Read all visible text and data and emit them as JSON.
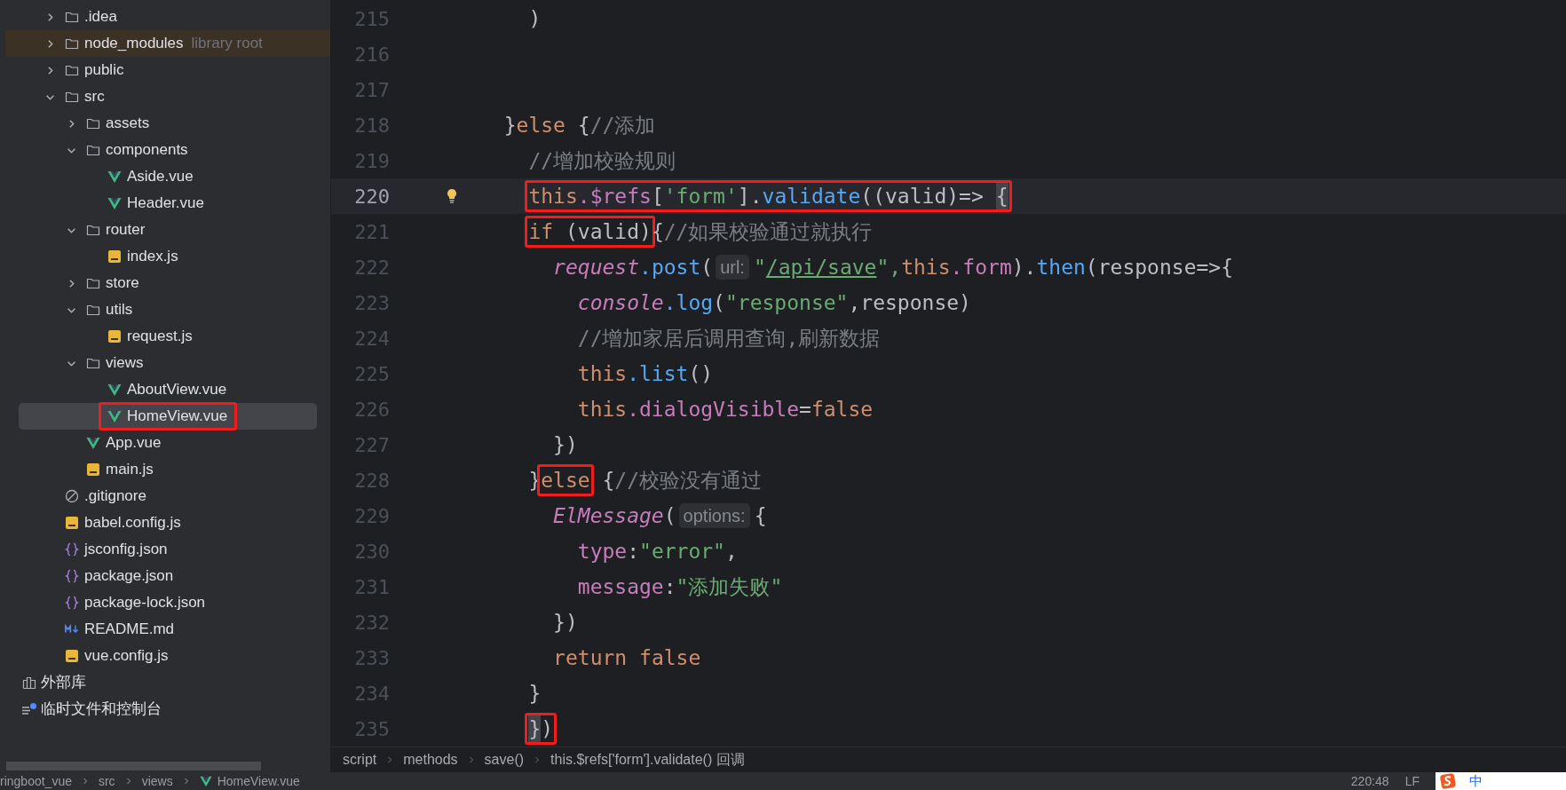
{
  "project_tree": {
    "items": [
      {
        "name": ".idea",
        "kind": "folder",
        "expanded": false,
        "selected": false,
        "boxed": false
      },
      {
        "name": "node_modules",
        "kind": "folder",
        "expanded": false,
        "selected": false,
        "boxed": false,
        "note": "library root"
      },
      {
        "name": "public",
        "kind": "folder",
        "expanded": false,
        "selected": false,
        "boxed": false
      },
      {
        "name": "src",
        "kind": "folder",
        "expanded": true,
        "selected": false,
        "boxed": false,
        "children": [
          {
            "name": "assets",
            "kind": "folder",
            "expanded": false,
            "selected": false,
            "boxed": false
          },
          {
            "name": "components",
            "kind": "folder",
            "expanded": true,
            "selected": false,
            "boxed": false,
            "children": [
              {
                "name": "Aside.vue",
                "kind": "vue",
                "selected": false,
                "boxed": false
              },
              {
                "name": "Header.vue",
                "kind": "vue",
                "selected": false,
                "boxed": false
              }
            ]
          },
          {
            "name": "router",
            "kind": "folder",
            "expanded": true,
            "selected": false,
            "boxed": false,
            "children": [
              {
                "name": "index.js",
                "kind": "js",
                "selected": false,
                "boxed": false
              }
            ]
          },
          {
            "name": "store",
            "kind": "folder",
            "expanded": false,
            "selected": false,
            "boxed": false
          },
          {
            "name": "utils",
            "kind": "folder",
            "expanded": true,
            "selected": false,
            "boxed": false,
            "children": [
              {
                "name": "request.js",
                "kind": "js",
                "selected": false,
                "boxed": false
              }
            ]
          },
          {
            "name": "views",
            "kind": "folder",
            "expanded": true,
            "selected": false,
            "boxed": false,
            "children": [
              {
                "name": "AboutView.vue",
                "kind": "vue",
                "selected": false,
                "boxed": false
              },
              {
                "name": "HomeView.vue",
                "kind": "vue",
                "selected": true,
                "boxed": true
              }
            ]
          },
          {
            "name": "App.vue",
            "kind": "vue",
            "selected": false,
            "boxed": false
          },
          {
            "name": "main.js",
            "kind": "js",
            "selected": false,
            "boxed": false
          }
        ]
      },
      {
        "name": ".gitignore",
        "kind": "gitignore",
        "selected": false,
        "boxed": false
      },
      {
        "name": "babel.config.js",
        "kind": "js",
        "selected": false,
        "boxed": false
      },
      {
        "name": "jsconfig.json",
        "kind": "json",
        "selected": false,
        "boxed": false
      },
      {
        "name": "package.json",
        "kind": "json",
        "selected": false,
        "boxed": false
      },
      {
        "name": "package-lock.json",
        "kind": "json",
        "selected": false,
        "boxed": false
      },
      {
        "name": "README.md",
        "kind": "md",
        "selected": false,
        "boxed": false
      },
      {
        "name": "vue.config.js",
        "kind": "js",
        "selected": false,
        "boxed": false
      }
    ],
    "extras": [
      {
        "name": "外部库",
        "kind": "library"
      },
      {
        "name": "临时文件和控制台",
        "kind": "scratches"
      }
    ]
  },
  "editor": {
    "lines": [
      {
        "n": "215",
        "current": false,
        "bulb": false,
        "tokens": [
          {
            "t": "    )",
            "kind": "plain"
          }
        ]
      },
      {
        "n": "216",
        "current": false,
        "bulb": false
      },
      {
        "n": "217",
        "current": false,
        "bulb": false
      },
      {
        "n": "218",
        "current": false,
        "bulb": false,
        "tokens": [
          {
            "t": "  }",
            "kind": "plain"
          },
          {
            "t": "else",
            "kind": "keyword"
          },
          {
            "t": " {",
            "kind": "plain"
          },
          {
            "t": "//添加",
            "kind": "comment"
          }
        ]
      },
      {
        "n": "219",
        "current": false,
        "bulb": false,
        "tokens": [
          {
            "t": "    //增加校验规则",
            "kind": "comment"
          }
        ]
      },
      {
        "n": "220",
        "current": true,
        "bulb": true,
        "tokens": [
          {
            "boxed": true,
            "tokens": [
              {
                "t": "    this",
                "kind": "keyword"
              },
              {
                "t": ".$refs",
                "kind": "prop"
              },
              {
                "t": "[",
                "kind": "plain"
              },
              {
                "t": "'form'",
                "kind": "string"
              },
              {
                "t": "].",
                "kind": "plain"
              },
              {
                "t": "validate",
                "kind": "func"
              },
              {
                "t": "((valid)=> ",
                "kind": "plain"
              },
              {
                "t": "{",
                "kind": "plain",
                "matched": true
              }
            ]
          }
        ]
      },
      {
        "n": "221",
        "current": false,
        "bulb": false,
        "tokens": [
          {
            "boxed": true,
            "tokens": [
              {
                "t": "    if",
                "kind": "keyword"
              },
              {
                "t": " (valid)",
                "kind": "plain"
              }
            ]
          },
          {
            "t": "{",
            "kind": "plain"
          },
          {
            "t": "//如果校验通过就执行",
            "kind": "comment"
          }
        ]
      },
      {
        "n": "222",
        "current": false,
        "bulb": false,
        "tokens": [
          {
            "t": "      request",
            "kind": "global"
          },
          {
            "t": ".post",
            "kind": "func"
          },
          {
            "t": "(",
            "kind": "plain"
          },
          {
            "t": "url:",
            "kind": "hint"
          },
          {
            "t": "\"",
            "kind": "string"
          },
          {
            "t": "/api/save",
            "kind": "url"
          },
          {
            "t": "\",",
            "kind": "string"
          },
          {
            "t": "this",
            "kind": "keyword"
          },
          {
            "t": ".form",
            "kind": "prop"
          },
          {
            "t": ").",
            "kind": "plain"
          },
          {
            "t": "then",
            "kind": "func"
          },
          {
            "t": "(response=>{",
            "kind": "plain"
          }
        ]
      },
      {
        "n": "223",
        "current": false,
        "bulb": false,
        "tokens": [
          {
            "t": "        console",
            "kind": "global"
          },
          {
            "t": ".log",
            "kind": "func"
          },
          {
            "t": "(",
            "kind": "plain"
          },
          {
            "t": "\"response\"",
            "kind": "string"
          },
          {
            "t": ",response)",
            "kind": "plain"
          }
        ]
      },
      {
        "n": "224",
        "current": false,
        "bulb": false,
        "tokens": [
          {
            "t": "        //增加家居后调用查询,刷新数据",
            "kind": "comment"
          }
        ]
      },
      {
        "n": "225",
        "current": false,
        "bulb": false,
        "tokens": [
          {
            "t": "        this",
            "kind": "keyword"
          },
          {
            "t": ".list",
            "kind": "func"
          },
          {
            "t": "()",
            "kind": "plain"
          }
        ]
      },
      {
        "n": "226",
        "current": false,
        "bulb": false,
        "tokens": [
          {
            "t": "        this",
            "kind": "keyword"
          },
          {
            "t": ".dialogVisible",
            "kind": "prop"
          },
          {
            "t": "=",
            "kind": "plain"
          },
          {
            "t": "false",
            "kind": "keyword"
          }
        ]
      },
      {
        "n": "227",
        "current": false,
        "bulb": false,
        "tokens": [
          {
            "t": "      })",
            "kind": "plain"
          }
        ]
      },
      {
        "n": "228",
        "current": false,
        "bulb": false,
        "tokens": [
          {
            "t": "    }",
            "kind": "plain"
          },
          {
            "boxed": true,
            "tokens": [
              {
                "t": "else",
                "kind": "keyword"
              }
            ]
          },
          {
            "t": " {",
            "kind": "plain"
          },
          {
            "t": "//校验没有通过",
            "kind": "comment"
          }
        ]
      },
      {
        "n": "229",
        "current": false,
        "bulb": false,
        "tokens": [
          {
            "t": "      ElMessage",
            "kind": "global"
          },
          {
            "t": "(",
            "kind": "plain"
          },
          {
            "t": "options:",
            "kind": "hint"
          },
          {
            "t": "{",
            "kind": "plain"
          }
        ]
      },
      {
        "n": "230",
        "current": false,
        "bulb": false,
        "tokens": [
          {
            "t": "        type",
            "kind": "prop"
          },
          {
            "t": ":",
            "kind": "plain"
          },
          {
            "t": "\"error\"",
            "kind": "string"
          },
          {
            "t": ",",
            "kind": "plain"
          }
        ]
      },
      {
        "n": "231",
        "current": false,
        "bulb": false,
        "tokens": [
          {
            "t": "        message",
            "kind": "prop"
          },
          {
            "t": ":",
            "kind": "plain"
          },
          {
            "t": "\"添加失败\"",
            "kind": "string"
          }
        ]
      },
      {
        "n": "232",
        "current": false,
        "bulb": false,
        "tokens": [
          {
            "t": "      })",
            "kind": "plain"
          }
        ]
      },
      {
        "n": "233",
        "current": false,
        "bulb": false,
        "tokens": [
          {
            "t": "      return",
            "kind": "keyword"
          },
          {
            "t": " false",
            "kind": "keyword"
          }
        ]
      },
      {
        "n": "234",
        "current": false,
        "bulb": false,
        "tokens": [
          {
            "t": "    }",
            "kind": "plain"
          }
        ]
      },
      {
        "n": "235",
        "current": false,
        "bulb": false,
        "tokens": [
          {
            "boxed": true,
            "tokens": [
              {
                "t": "    }",
                "kind": "plain",
                "matched": true
              },
              {
                "t": ")",
                "kind": "plain"
              }
            ]
          }
        ]
      }
    ],
    "breadcrumb": [
      "script",
      "methods",
      "save()",
      "this.$refs['form'].validate() 回调"
    ]
  },
  "status_bar": {
    "path": [
      {
        "name": "ringboot_vue",
        "kind": "folder"
      },
      {
        "name": "src",
        "kind": "folder"
      },
      {
        "name": "views",
        "kind": "folder"
      },
      {
        "name": "HomeView.vue",
        "kind": "vue"
      }
    ],
    "position": "220:48",
    "line_separator": "LF",
    "ime": {
      "label": "中"
    }
  }
}
